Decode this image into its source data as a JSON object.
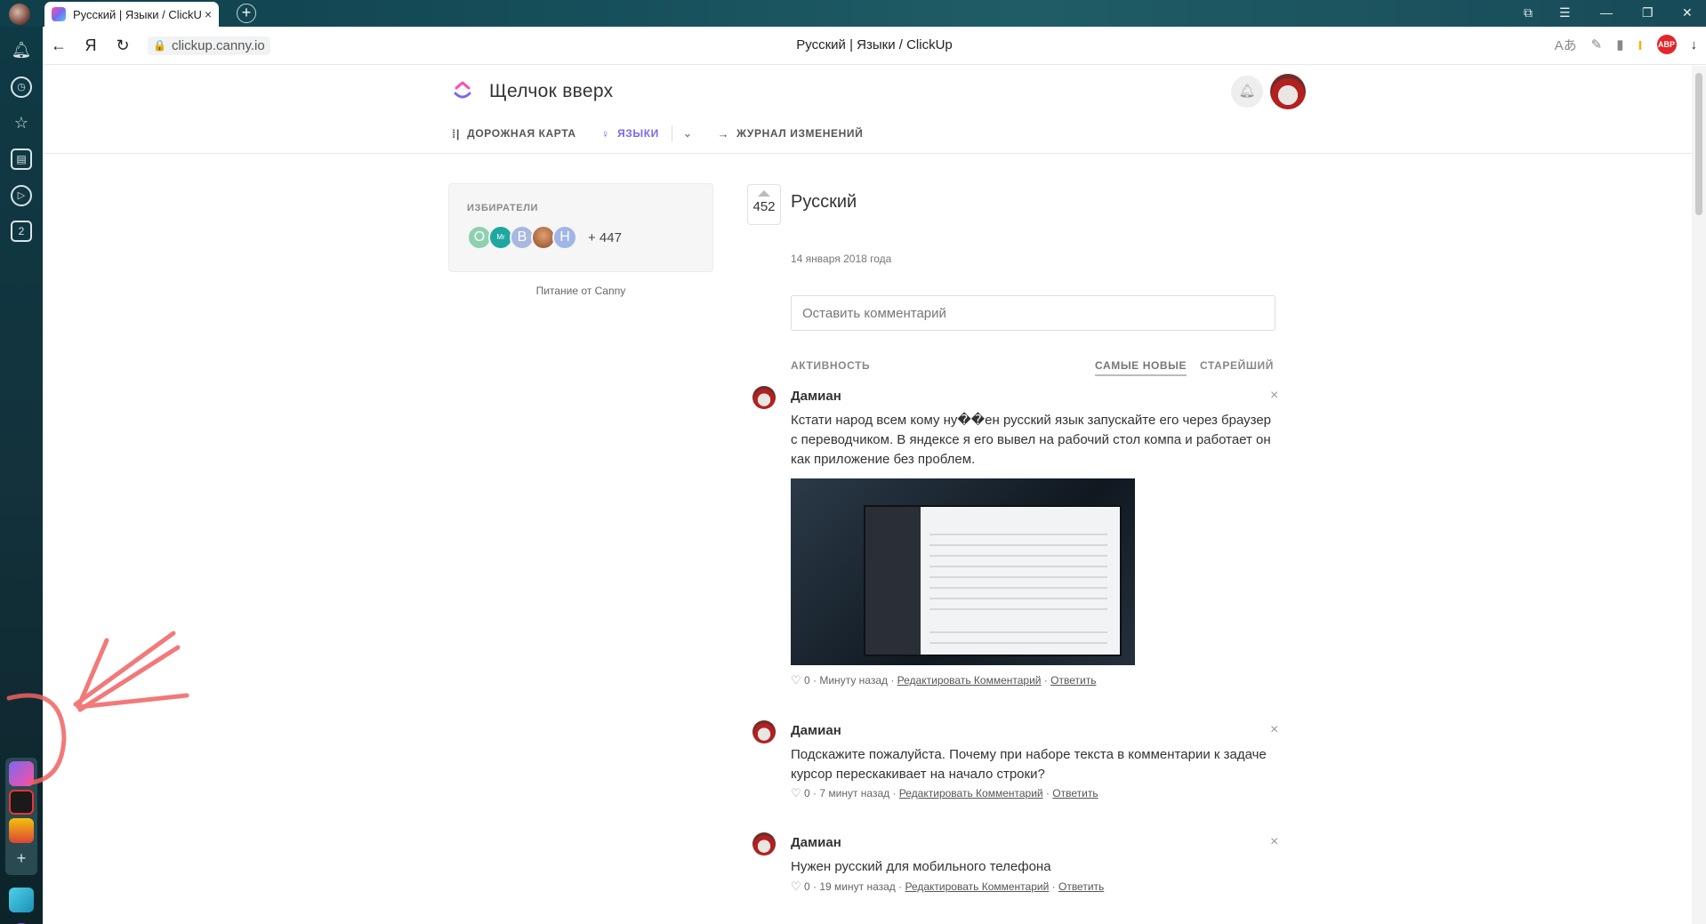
{
  "browser": {
    "tab_title": "Русский | Языки / ClickUp",
    "tab_close": "×",
    "new_tab": "+",
    "url": "clickup.canny.io",
    "page_title": "Русский | Языки / ClickUp",
    "yandex_logo": "Я",
    "abp_label": "ABP",
    "sidebar_badge": "2"
  },
  "site": {
    "brand": "Щелчок вверх",
    "nav": {
      "roadmap": "ДОРОЖНАЯ КАРТА",
      "languages": "ЯЗЫКИ",
      "changelog": "ЖУРНАЛ ИЗМЕНЕНИЙ"
    }
  },
  "voters": {
    "label": "ИЗБИРАТЕЛИ",
    "avatars": [
      {
        "letter": "О",
        "color": "#8fd0b0"
      },
      {
        "letter": "Mr",
        "color": "#1fa7a0"
      },
      {
        "letter": "В",
        "color": "#a9b8e0"
      },
      {
        "letter": "",
        "color": "#b5603a"
      },
      {
        "letter": "Н",
        "color": "#9fb6e6"
      }
    ],
    "more": "+ 447",
    "powered_by": "Питание от Canny"
  },
  "post": {
    "votes": "452",
    "title": "Русский",
    "date": "14 января 2018 года",
    "comment_placeholder": "Оставить комментарий",
    "activity_label": "АКТИВНОСТЬ",
    "sort_newest": "САМЫЕ НОВЫЕ",
    "sort_oldest": "СТАРЕЙШИЙ"
  },
  "comments": [
    {
      "author": "Дамиан",
      "text": "Кстати народ всем кому ну��ен русский язык запускайте его через браузер с переводчиком. В яндексе я его вывел на рабочий стол компа и работает он как приложение без проблем.",
      "likes": "0",
      "time": "· Минуту назад ·",
      "edit": "Редактировать Комментарий",
      "reply": "Ответить",
      "sep": "·"
    },
    {
      "author": "Дамиан",
      "text": "Подскажите пожалуйста. Почему при наборе текста в комментарии к задаче курсор перескакивает на начало строки?",
      "likes": "0",
      "time": "· 7 минут назад ·",
      "edit": "Редактировать Комментарий",
      "reply": "Ответить",
      "sep": "·"
    },
    {
      "author": "Дамиан",
      "text": "Нужен русский для мобильного телефона",
      "likes": "0",
      "time": "· 19 минут назад ·",
      "edit": "Редактировать Комментарий",
      "reply": "Ответить",
      "sep": "·"
    }
  ],
  "icons": {
    "heart": "♡",
    "close": "×",
    "back": "←",
    "reload": "↻",
    "download": "↓"
  }
}
